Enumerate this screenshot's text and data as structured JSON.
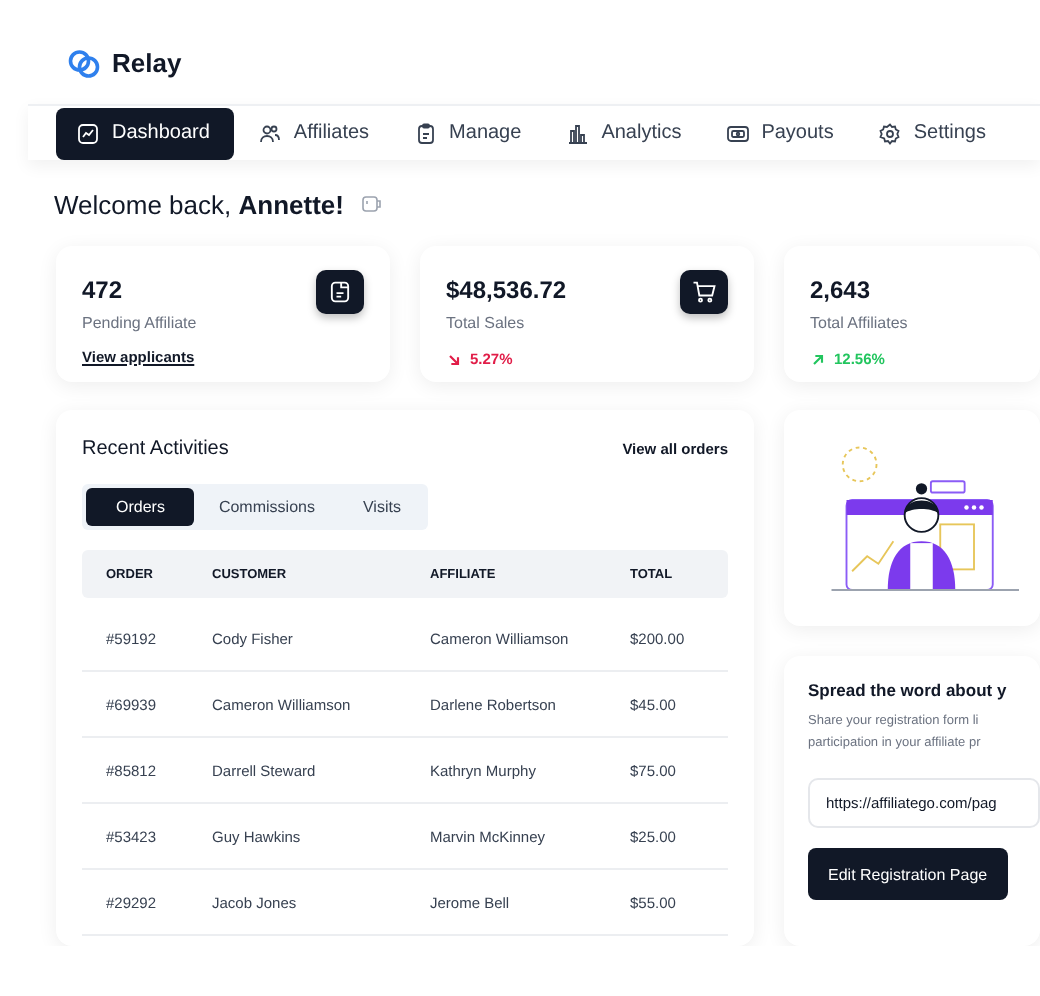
{
  "brand": {
    "name": "Relay"
  },
  "nav": [
    {
      "label": "Dashboard",
      "selected": true
    },
    {
      "label": "Affiliates",
      "selected": false
    },
    {
      "label": "Manage",
      "selected": false
    },
    {
      "label": "Analytics",
      "selected": false
    },
    {
      "label": "Payouts",
      "selected": false
    },
    {
      "label": "Settings",
      "selected": false
    }
  ],
  "welcome": {
    "text": "Welcome back, **Annette!**"
  },
  "stats": [
    {
      "kind": "link",
      "value": "472",
      "label": "Pending Affiliate",
      "link": "View applicants"
    },
    {
      "kind": "falling",
      "value": "$48,536.72",
      "label": "Total Sales",
      "change": "5.27%"
    },
    {
      "kind": "rising",
      "value": "2,643",
      "label": "Total Affiliates",
      "change": "12.56%"
    }
  ],
  "activities": {
    "title": "Recent Activities",
    "link": "View all orders",
    "tabs": [
      {
        "label": "Orders",
        "selected": true
      },
      {
        "label": "Commissions",
        "selected": false
      },
      {
        "label": "Visits",
        "selected": false
      }
    ],
    "columns": [
      "ORDER",
      "CUSTOMER",
      "AFFILIATE",
      "TOTAL"
    ],
    "rows": [
      [
        "#59192",
        "Cody Fisher",
        "Cameron Williamson",
        "$200.00"
      ],
      [
        "#69939",
        "Cameron Williamson",
        "Darlene Robertson",
        "$45.00"
      ],
      [
        "#85812",
        "Darrell Steward",
        "Kathryn Murphy",
        "$75.00"
      ],
      [
        "#53423",
        "Guy Hawkins",
        "Marvin McKinney",
        "$25.00"
      ],
      [
        "#29292",
        "Jacob Jones",
        "Jerome Bell",
        "$55.00"
      ]
    ]
  },
  "share": {
    "title": "Spread the word about y",
    "lines": [
      "Share your registration form li",
      "participation in your affiliate pr"
    ],
    "url": "https://affiliatego.com/pag",
    "button": "Edit Registration Page"
  }
}
